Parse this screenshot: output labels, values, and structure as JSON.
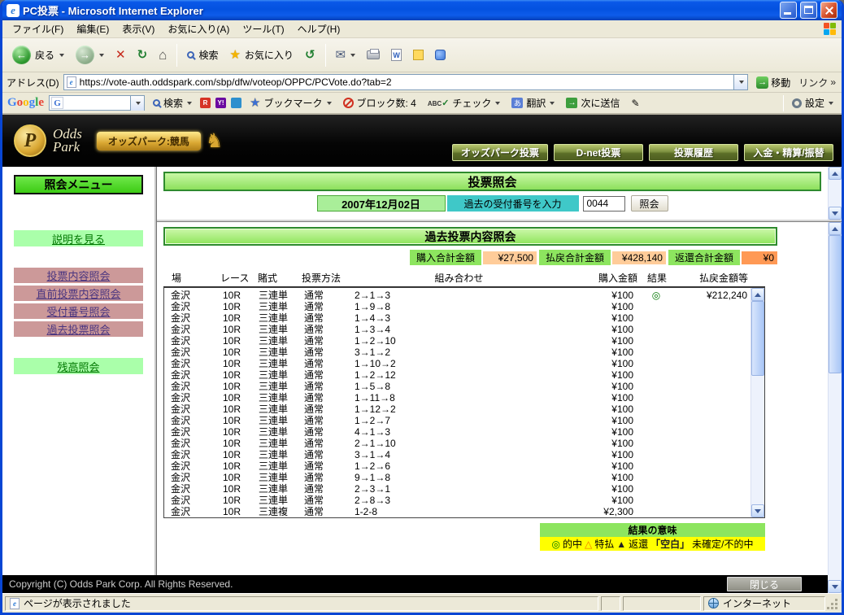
{
  "window": {
    "title": "PC投票 - Microsoft Internet Explorer"
  },
  "menu_bar": {
    "items": [
      "ファイル(F)",
      "編集(E)",
      "表示(V)",
      "お気に入り(A)",
      "ツール(T)",
      "ヘルプ(H)"
    ]
  },
  "toolbar": {
    "back_label": "戻る",
    "search_label": "検索",
    "favorites_label": "お気に入り"
  },
  "address_bar": {
    "label": "アドレス(D)",
    "url": "https://vote-auth.oddspark.com/sbp/dfw/voteop/OPPC/PCVote.do?tab=2",
    "go_label": "移動",
    "links_label": "リンク",
    "links_chevron": "»"
  },
  "google_bar": {
    "logo": "Google",
    "logo_colors": [
      "#4285F4",
      "#EA4335",
      "#FBBC05",
      "#4285F4",
      "#34A853",
      "#EA4335"
    ],
    "search_label": "検索",
    "bookmarks_label": "ブックマーク",
    "block_label": "ブロック数: 4",
    "check_abc": "ABC",
    "check_mark": "✓",
    "check_label": "チェック",
    "translate_label": "翻訳",
    "send_label": "次に送信",
    "settings_label": "設定"
  },
  "site_header": {
    "emblem_letter": "P",
    "brand_line1": "Odds",
    "brand_line2": "Park",
    "badge": "オッズパーク:競馬",
    "nav": [
      "オッズパーク投票",
      "D-net投票",
      "投票履歴",
      "入金・精算/振替"
    ]
  },
  "sidebar": {
    "title": "照会メニュー",
    "help_label": "説明を見る",
    "items": [
      {
        "label": "投票内容照会"
      },
      {
        "label": "直前投票内容照会"
      },
      {
        "label": "受付番号照会"
      },
      {
        "label": "過去投票照会"
      }
    ],
    "balance_label": "残高照会"
  },
  "main": {
    "vote_title": "投票照会",
    "date": "2007年12月02日",
    "receipt_label": "過去の受付番号を入力",
    "receipt_value": "0044",
    "inquiry_button": "照会",
    "section_title": "過去投票内容照会",
    "summary": [
      {
        "label": "購入合計金額",
        "value": "¥27,500"
      },
      {
        "label": "払戻合計金額",
        "value": "¥428,140"
      },
      {
        "label": "返還合計金額",
        "value": "¥0"
      }
    ],
    "table": {
      "headers": [
        "場",
        "レース",
        "賭式",
        "投票方法",
        "組み合わせ",
        "購入金額",
        "結果",
        "払戻金額等"
      ],
      "rows": [
        [
          "金沢",
          "10R",
          "三連単",
          "通常",
          "2→1→3",
          "¥100",
          "◎",
          "¥212,240"
        ],
        [
          "金沢",
          "10R",
          "三連単",
          "通常",
          "1→9→8",
          "¥100",
          "",
          ""
        ],
        [
          "金沢",
          "10R",
          "三連単",
          "通常",
          "1→4→3",
          "¥100",
          "",
          ""
        ],
        [
          "金沢",
          "10R",
          "三連単",
          "通常",
          "1→3→4",
          "¥100",
          "",
          ""
        ],
        [
          "金沢",
          "10R",
          "三連単",
          "通常",
          "1→2→10",
          "¥100",
          "",
          ""
        ],
        [
          "金沢",
          "10R",
          "三連単",
          "通常",
          "3→1→2",
          "¥100",
          "",
          ""
        ],
        [
          "金沢",
          "10R",
          "三連単",
          "通常",
          "1→10→2",
          "¥100",
          "",
          ""
        ],
        [
          "金沢",
          "10R",
          "三連単",
          "通常",
          "1→2→12",
          "¥100",
          "",
          ""
        ],
        [
          "金沢",
          "10R",
          "三連単",
          "通常",
          "1→5→8",
          "¥100",
          "",
          ""
        ],
        [
          "金沢",
          "10R",
          "三連単",
          "通常",
          "1→11→8",
          "¥100",
          "",
          ""
        ],
        [
          "金沢",
          "10R",
          "三連単",
          "通常",
          "1→12→2",
          "¥100",
          "",
          ""
        ],
        [
          "金沢",
          "10R",
          "三連単",
          "通常",
          "1→2→7",
          "¥100",
          "",
          ""
        ],
        [
          "金沢",
          "10R",
          "三連単",
          "通常",
          "4→1→3",
          "¥100",
          "",
          ""
        ],
        [
          "金沢",
          "10R",
          "三連単",
          "通常",
          "2→1→10",
          "¥100",
          "",
          ""
        ],
        [
          "金沢",
          "10R",
          "三連単",
          "通常",
          "3→1→4",
          "¥100",
          "",
          ""
        ],
        [
          "金沢",
          "10R",
          "三連単",
          "通常",
          "1→2→6",
          "¥100",
          "",
          ""
        ],
        [
          "金沢",
          "10R",
          "三連単",
          "通常",
          "9→1→8",
          "¥100",
          "",
          ""
        ],
        [
          "金沢",
          "10R",
          "三連単",
          "通常",
          "2→3→1",
          "¥100",
          "",
          ""
        ],
        [
          "金沢",
          "10R",
          "三連単",
          "通常",
          "2→8→3",
          "¥100",
          "",
          ""
        ],
        [
          "金沢",
          "10R",
          "三連複",
          "通常",
          "1-2-8",
          "¥2,300",
          "",
          ""
        ]
      ]
    },
    "legend": {
      "title": "結果の意味",
      "items": [
        {
          "symbol": "◎",
          "label": "的中",
          "color": "#007700"
        },
        {
          "symbol": "△",
          "label": "特払",
          "color": "#EE7700"
        },
        {
          "symbol": "▲",
          "label": "返還",
          "color": "#222222"
        },
        {
          "symbol": "「空白」",
          "label": "未確定/不的中",
          "color": "#222222"
        }
      ]
    }
  },
  "footer": {
    "copyright": "Copyright (C) Odds Park Corp. All Rights Reserved.",
    "close_label": "閉じる"
  },
  "status_bar": {
    "text": "ページが表示されました",
    "zone": "インターネット"
  },
  "icons": {
    "ie_e": "e",
    "back_arrow": "←",
    "forward_arrow": "→",
    "stop_x": "✕",
    "refresh": "↻",
    "home": "⌂",
    "favorites_star": "★",
    "history": "↺",
    "mail": "✉",
    "edit_w": "W",
    "google_g": "G",
    "mini_r": "R",
    "mini_y": "Y!",
    "go_arrow": "→",
    "send_arrow": "→",
    "pencil": "✎",
    "translate_char": "あ",
    "bookmark_star": "★",
    "horse": "♞",
    "result_hit": "◎"
  },
  "colors": {
    "titlebar_blue": "#0054E3",
    "header_green": "#8FE55C",
    "header_border_green": "#2E8B2E",
    "summary_label_green": "#8DE55F",
    "summary_value_orange": "#FFCC99",
    "return_value_orange": "#FF9955",
    "sidebar_pink": "#CC9999",
    "sidebar_green": "#AAFFAA",
    "menu_title_green": "#3CCB14",
    "legend_yellow": "#FFFF00",
    "nav_olive": "#7E9140",
    "badge_gold": "#D9A732"
  }
}
